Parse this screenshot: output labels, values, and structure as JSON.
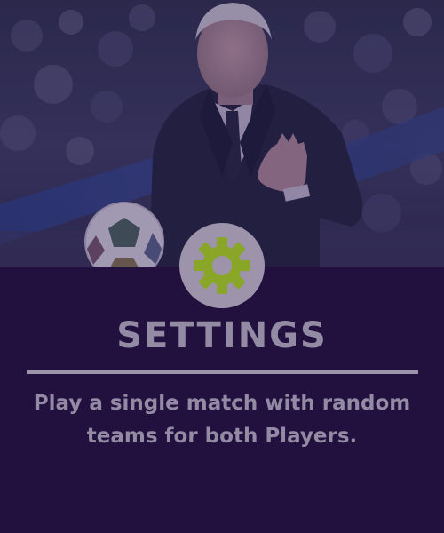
{
  "card": {
    "icon": "gear-icon",
    "title": "SETTINGS",
    "description": "Play a single match with random teams for both Players."
  },
  "colors": {
    "panel_background": "#22103f",
    "text": "#938aa3",
    "divider": "#9d93ab",
    "badge_background": "#9d93ab",
    "gear": "#8aa628"
  }
}
